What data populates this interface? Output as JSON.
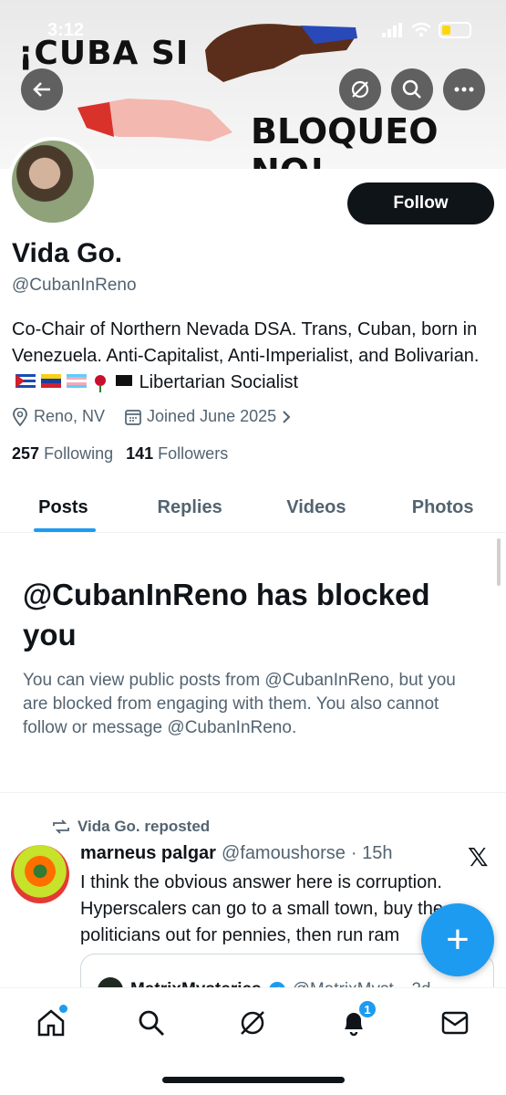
{
  "status": {
    "time": "3:12"
  },
  "banner": {
    "text_top": "¡CUBA SI",
    "text_bottom": "BLOQUEO NO!"
  },
  "header_buttons": [
    "back-arrow-icon",
    "grok-icon",
    "search-icon",
    "more-icon"
  ],
  "profile": {
    "name": "Vida Go.",
    "handle": "@CubanInReno",
    "follow_label": "Follow",
    "bio": "Co-Chair of Northern Nevada DSA. Trans, Cuban, born in Venezuela. Anti-Capitalist, Anti-Imperialist, and Bolivarian.",
    "bio_emojis": [
      "cuban-flag",
      "venezuelan-flag",
      "trans-flag",
      "rose",
      "black-flag"
    ],
    "bio_suffix": "Libertarian Socialist",
    "location": "Reno, NV",
    "joined": "Joined June 2025",
    "following_count": "257",
    "following_label": "Following",
    "followers_count": "141",
    "followers_label": "Followers"
  },
  "tabs": [
    {
      "label": "Posts",
      "active": true
    },
    {
      "label": "Replies",
      "active": false
    },
    {
      "label": "Videos",
      "active": false
    },
    {
      "label": "Photos",
      "active": false
    }
  ],
  "blocked": {
    "title": "@CubanInReno has blocked you",
    "body": "You can view public posts from @CubanInReno, but you are blocked from engaging with them. You also cannot follow or message @CubanInReno."
  },
  "post": {
    "repost_label": "Vida Go. reposted",
    "author": "marneus palgar",
    "author_handle": "@famoushorse",
    "time": "· 15h",
    "text": "I think the obvious answer here is corruption. Hyperscalers can go to a small town, buy the politicians out for pennies, then run ram",
    "quote_author": "MatrixMysteries",
    "quote_handle": "@MatrixMyst",
    "quote_time": "· 2d"
  },
  "fab_label": "+",
  "bottom_nav": {
    "notifications_badge": "1"
  },
  "colors": {
    "accent": "#1d9bf0",
    "text": "#0f1419",
    "muted": "#536471"
  }
}
